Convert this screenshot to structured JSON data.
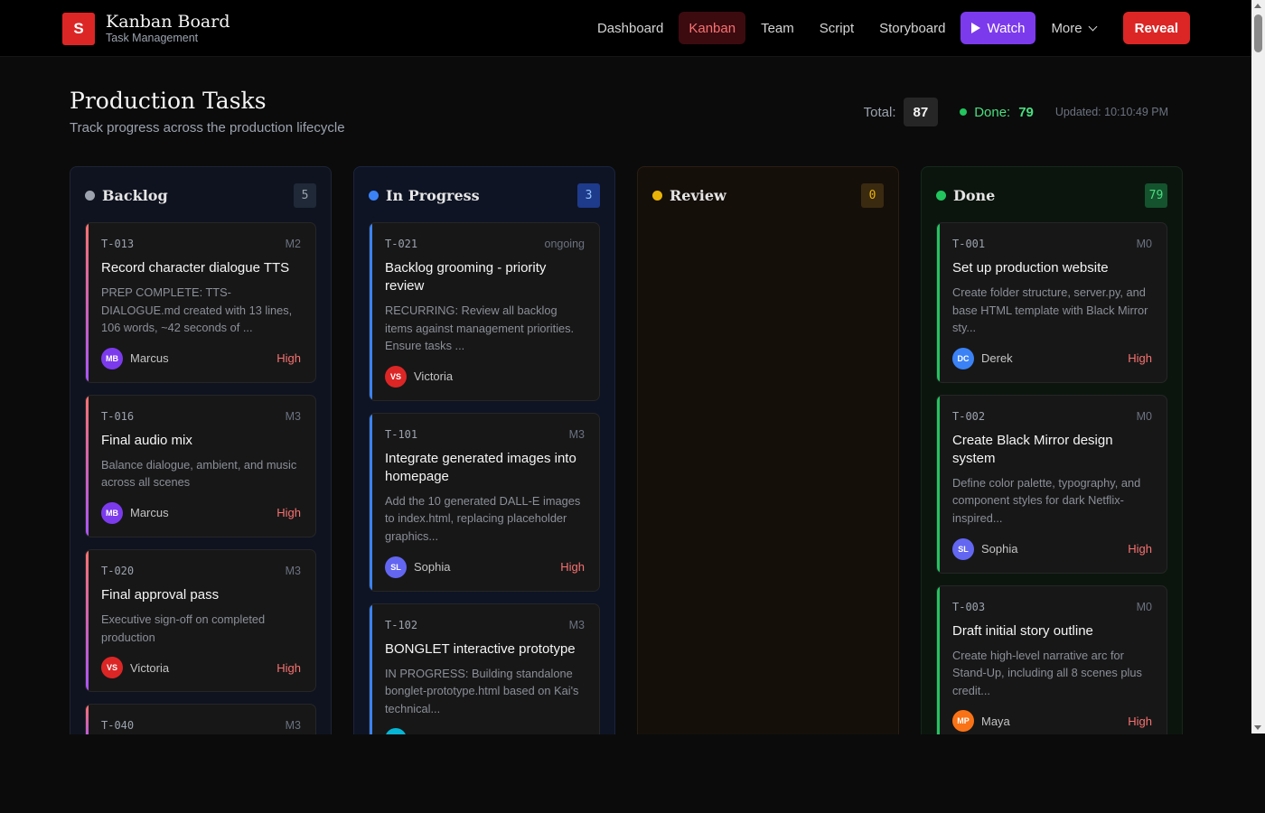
{
  "brand": {
    "logo_letter": "S",
    "title": "Kanban Board",
    "subtitle": "Task Management"
  },
  "nav": {
    "items": [
      "Dashboard",
      "Kanban",
      "Team",
      "Script",
      "Storyboard"
    ],
    "active": "Kanban",
    "watch_label": "Watch",
    "more_label": "More",
    "reveal_label": "Reveal"
  },
  "header": {
    "title": "Production Tasks",
    "subtitle": "Track progress across the production lifecycle",
    "total_label": "Total:",
    "total_value": "87",
    "done_label": "Done:",
    "done_value": "79",
    "updated": "Updated: 10:10:49 PM"
  },
  "colors": {
    "accent": "#dc2626",
    "watch": "#7c3aed",
    "backlog": "#9ca3af",
    "in_progress": "#3b82f6",
    "review": "#eab308",
    "done": "#22c55e"
  },
  "columns": [
    {
      "key": "backlog",
      "title": "Backlog",
      "count": "5",
      "cards": [
        {
          "id": "T-013",
          "tag": "M2",
          "title": "Record character dialogue TTS",
          "desc": "PREP COMPLETE: TTS-DIALOGUE.md created with 13 lines, 106 words, ~42 seconds of ...",
          "initials": "MB",
          "assignee": "Marcus",
          "priority": "High",
          "avatar_color": "#7c3aed"
        },
        {
          "id": "T-016",
          "tag": "M3",
          "title": "Final audio mix",
          "desc": "Balance dialogue, ambient, and music across all scenes",
          "initials": "MB",
          "assignee": "Marcus",
          "priority": "High",
          "avatar_color": "#7c3aed"
        },
        {
          "id": "T-020",
          "tag": "M3",
          "title": "Final approval pass",
          "desc": "Executive sign-off on completed production",
          "initials": "VS",
          "assignee": "Victoria",
          "priority": "High",
          "avatar_color": "#dc2626"
        },
        {
          "id": "T-040",
          "tag": "M3",
          "title": "",
          "desc": "",
          "initials": "",
          "assignee": "",
          "priority": "",
          "avatar_color": "#7c3aed"
        }
      ]
    },
    {
      "key": "progress",
      "title": "In Progress",
      "count": "3",
      "cards": [
        {
          "id": "T-021",
          "tag": "ongoing",
          "title": "Backlog grooming - priority review",
          "desc": "RECURRING: Review all backlog items against management priorities. Ensure tasks ...",
          "initials": "VS",
          "assignee": "Victoria",
          "priority": "",
          "avatar_color": "#dc2626"
        },
        {
          "id": "T-101",
          "tag": "M3",
          "title": "Integrate generated images into homepage",
          "desc": "Add the 10 generated DALL-E images to index.html, replacing placeholder graphics...",
          "initials": "SL",
          "assignee": "Sophia",
          "priority": "High",
          "avatar_color": "#6366f1"
        },
        {
          "id": "T-102",
          "tag": "M3",
          "title": "BONGLET interactive prototype",
          "desc": "IN PROGRESS: Building standalone bonglet-prototype.html based on Kai's technical...",
          "initials": "",
          "assignee": "",
          "priority": "",
          "avatar_color": "#06b6d4"
        }
      ]
    },
    {
      "key": "review",
      "title": "Review",
      "count": "0",
      "cards": []
    },
    {
      "key": "done",
      "title": "Done",
      "count": "79",
      "cards": [
        {
          "id": "T-001",
          "tag": "M0",
          "title": "Set up production website",
          "desc": "Create folder structure, server.py, and base HTML template with Black Mirror sty...",
          "initials": "DC",
          "assignee": "Derek",
          "priority": "High",
          "avatar_color": "#3b82f6"
        },
        {
          "id": "T-002",
          "tag": "M0",
          "title": "Create Black Mirror design system",
          "desc": "Define color palette, typography, and component styles for dark Netflix-inspired...",
          "initials": "SL",
          "assignee": "Sophia",
          "priority": "High",
          "avatar_color": "#6366f1"
        },
        {
          "id": "T-003",
          "tag": "M0",
          "title": "Draft initial story outline",
          "desc": "Create high-level narrative arc for Stand-Up, including all 8 scenes plus credit...",
          "initials": "MP",
          "assignee": "Maya",
          "priority": "High",
          "avatar_color": "#f97316"
        }
      ]
    }
  ]
}
